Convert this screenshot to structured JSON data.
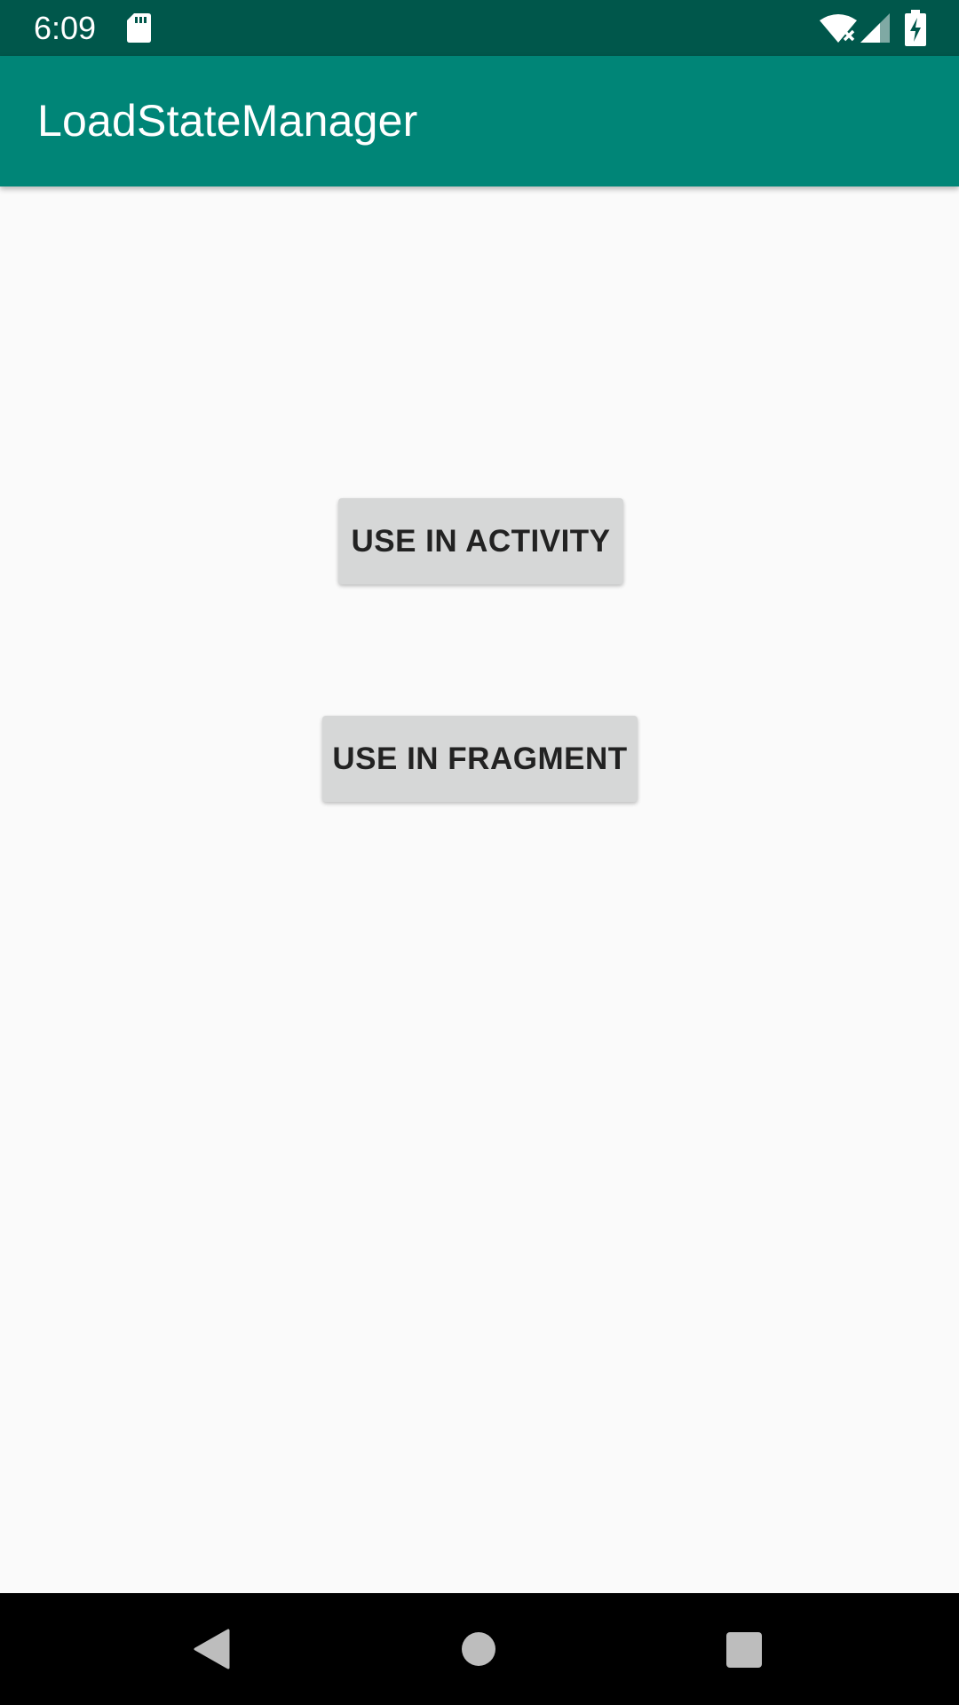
{
  "status_bar": {
    "time": "6:09",
    "icons": [
      "sd-card-icon",
      "wifi-icon",
      "signal-icon",
      "battery-charging-icon"
    ]
  },
  "app_bar": {
    "title": "LoadStateManager"
  },
  "main": {
    "buttons": [
      {
        "label": "USE IN ACTIVITY"
      },
      {
        "label": "USE IN FRAGMENT"
      }
    ]
  },
  "nav_bar": {
    "icons": [
      "back-icon",
      "home-icon",
      "recents-icon"
    ]
  },
  "colors": {
    "status_bar": "#00574b",
    "app_bar": "#008577",
    "background": "#fafafa",
    "button": "#d6d7d7",
    "button_text": "#222222",
    "nav_bar": "#000000"
  }
}
